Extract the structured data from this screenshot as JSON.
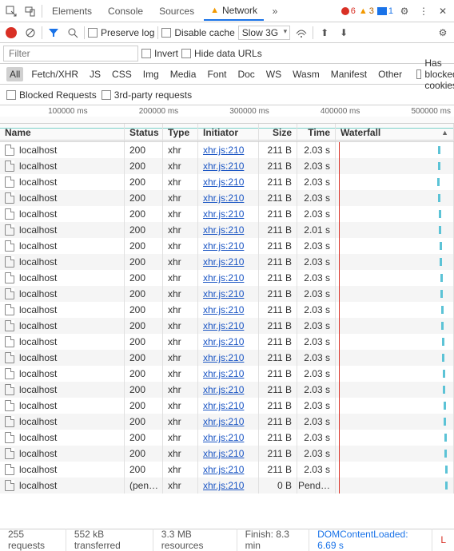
{
  "tabs": {
    "elements": "Elements",
    "console": "Console",
    "sources": "Sources",
    "network": "Network"
  },
  "badges": {
    "errors": "6",
    "warnings": "3",
    "messages": "1"
  },
  "toolbar": {
    "preserve": "Preserve log",
    "disable_cache": "Disable cache",
    "throttle": "Slow 3G"
  },
  "filter": {
    "placeholder": "Filter",
    "invert": "Invert",
    "hide_data": "Hide data URLs"
  },
  "types": {
    "all": "All",
    "fetch": "Fetch/XHR",
    "js": "JS",
    "css": "CSS",
    "img": "Img",
    "media": "Media",
    "font": "Font",
    "doc": "Doc",
    "ws": "WS",
    "wasm": "Wasm",
    "manifest": "Manifest",
    "other": "Other",
    "blocked_cookies": "Has blocked cookies",
    "blocked_req": "Blocked Requests",
    "third_party": "3rd-party requests"
  },
  "overview": {
    "t1": "100000 ms",
    "t2": "200000 ms",
    "t3": "300000 ms",
    "t4": "400000 ms",
    "t5": "500000 ms"
  },
  "headers": {
    "name": "Name",
    "status": "Status",
    "type": "Type",
    "initiator": "Initiator",
    "size": "Size",
    "time": "Time",
    "waterfall": "Waterfall"
  },
  "rows": [
    {
      "name": "localhost",
      "status": "200",
      "type": "xhr",
      "init": "xhr.js:210",
      "size": "211 B",
      "time": "2.03 s",
      "wf": 128
    },
    {
      "name": "localhost",
      "status": "200",
      "type": "xhr",
      "init": "xhr.js:210",
      "size": "211 B",
      "time": "2.03 s",
      "wf": 128
    },
    {
      "name": "localhost",
      "status": "200",
      "type": "xhr",
      "init": "xhr.js:210",
      "size": "211 B",
      "time": "2.03 s",
      "wf": 127
    },
    {
      "name": "localhost",
      "status": "200",
      "type": "xhr",
      "init": "xhr.js:210",
      "size": "211 B",
      "time": "2.03 s",
      "wf": 128
    },
    {
      "name": "localhost",
      "status": "200",
      "type": "xhr",
      "init": "xhr.js:210",
      "size": "211 B",
      "time": "2.03 s",
      "wf": 129
    },
    {
      "name": "localhost",
      "status": "200",
      "type": "xhr",
      "init": "xhr.js:210",
      "size": "211 B",
      "time": "2.01 s",
      "wf": 129
    },
    {
      "name": "localhost",
      "status": "200",
      "type": "xhr",
      "init": "xhr.js:210",
      "size": "211 B",
      "time": "2.03 s",
      "wf": 130
    },
    {
      "name": "localhost",
      "status": "200",
      "type": "xhr",
      "init": "xhr.js:210",
      "size": "211 B",
      "time": "2.03 s",
      "wf": 130
    },
    {
      "name": "localhost",
      "status": "200",
      "type": "xhr",
      "init": "xhr.js:210",
      "size": "211 B",
      "time": "2.03 s",
      "wf": 131
    },
    {
      "name": "localhost",
      "status": "200",
      "type": "xhr",
      "init": "xhr.js:210",
      "size": "211 B",
      "time": "2.03 s",
      "wf": 131
    },
    {
      "name": "localhost",
      "status": "200",
      "type": "xhr",
      "init": "xhr.js:210",
      "size": "211 B",
      "time": "2.03 s",
      "wf": 132
    },
    {
      "name": "localhost",
      "status": "200",
      "type": "xhr",
      "init": "xhr.js:210",
      "size": "211 B",
      "time": "2.03 s",
      "wf": 132
    },
    {
      "name": "localhost",
      "status": "200",
      "type": "xhr",
      "init": "xhr.js:210",
      "size": "211 B",
      "time": "2.03 s",
      "wf": 133
    },
    {
      "name": "localhost",
      "status": "200",
      "type": "xhr",
      "init": "xhr.js:210",
      "size": "211 B",
      "time": "2.03 s",
      "wf": 133
    },
    {
      "name": "localhost",
      "status": "200",
      "type": "xhr",
      "init": "xhr.js:210",
      "size": "211 B",
      "time": "2.03 s",
      "wf": 134
    },
    {
      "name": "localhost",
      "status": "200",
      "type": "xhr",
      "init": "xhr.js:210",
      "size": "211 B",
      "time": "2.03 s",
      "wf": 134
    },
    {
      "name": "localhost",
      "status": "200",
      "type": "xhr",
      "init": "xhr.js:210",
      "size": "211 B",
      "time": "2.03 s",
      "wf": 135
    },
    {
      "name": "localhost",
      "status": "200",
      "type": "xhr",
      "init": "xhr.js:210",
      "size": "211 B",
      "time": "2.03 s",
      "wf": 135
    },
    {
      "name": "localhost",
      "status": "200",
      "type": "xhr",
      "init": "xhr.js:210",
      "size": "211 B",
      "time": "2.03 s",
      "wf": 136
    },
    {
      "name": "localhost",
      "status": "200",
      "type": "xhr",
      "init": "xhr.js:210",
      "size": "211 B",
      "time": "2.03 s",
      "wf": 136
    },
    {
      "name": "localhost",
      "status": "200",
      "type": "xhr",
      "init": "xhr.js:210",
      "size": "211 B",
      "time": "2.03 s",
      "wf": 137
    },
    {
      "name": "localhost",
      "status": "(pen…",
      "type": "xhr",
      "init": "xhr.js:210",
      "size": "0 B",
      "time": "Pend…",
      "wf": 137
    }
  ],
  "status": {
    "requests": "255 requests",
    "transferred": "552 kB transferred",
    "resources": "3.3 MB resources",
    "finish": "Finish: 8.3 min",
    "dcl": "DOMContentLoaded: 6.69 s",
    "load_cut": "L"
  }
}
